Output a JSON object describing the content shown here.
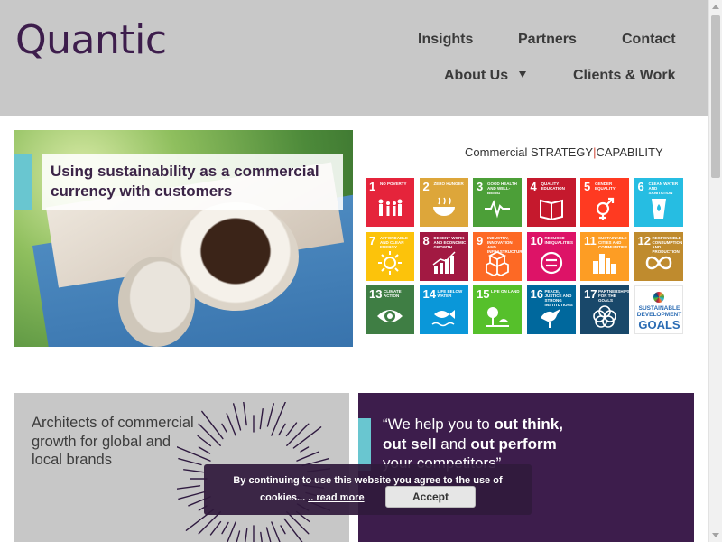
{
  "header": {
    "logo": "Quantic",
    "nav": {
      "insights": "Insights",
      "partners": "Partners",
      "contact": "Contact",
      "about_us": "About Us",
      "clients_work": "Clients & Work"
    }
  },
  "banner": {
    "caption": "Using sustainability as a commercial currency with customers",
    "sdg_title_part1": "Commercial STRATEGY",
    "sdg_title_part2": "CAPABILITY",
    "goals": [
      {
        "num": "1",
        "title": "No poverty",
        "color": "#e5243b",
        "icon": "family-icon"
      },
      {
        "num": "2",
        "title": "Zero hunger",
        "color": "#dda63a",
        "icon": "bowl-icon"
      },
      {
        "num": "3",
        "title": "Good health and well-being",
        "color": "#4c9f38",
        "icon": "heartbeat-icon"
      },
      {
        "num": "4",
        "title": "Quality education",
        "color": "#c5192d",
        "icon": "book-icon"
      },
      {
        "num": "5",
        "title": "Gender equality",
        "color": "#ff3a21",
        "icon": "gender-icon"
      },
      {
        "num": "6",
        "title": "Clean water and sanitation",
        "color": "#26bde2",
        "icon": "water-glass-icon"
      },
      {
        "num": "7",
        "title": "Affordable and clean energy",
        "color": "#fcc30b",
        "icon": "sun-icon"
      },
      {
        "num": "8",
        "title": "Decent work and economic growth",
        "color": "#a21942",
        "icon": "growth-chart-icon"
      },
      {
        "num": "9",
        "title": "Industry, innovation and infrastructure",
        "color": "#fd6925",
        "icon": "cubes-icon"
      },
      {
        "num": "10",
        "title": "Reduced inequalities",
        "color": "#dd1367",
        "icon": "equal-icon"
      },
      {
        "num": "11",
        "title": "Sustainable cities and communities",
        "color": "#fd9d24",
        "icon": "city-icon"
      },
      {
        "num": "12",
        "title": "Responsible consumption and production",
        "color": "#bf8b2e",
        "icon": "infinity-icon"
      },
      {
        "num": "13",
        "title": "Climate action",
        "color": "#3f7e44",
        "icon": "eye-globe-icon"
      },
      {
        "num": "14",
        "title": "Life below water",
        "color": "#0a97d9",
        "icon": "fish-icon"
      },
      {
        "num": "15",
        "title": "Life on land",
        "color": "#56c02b",
        "icon": "tree-icon"
      },
      {
        "num": "16",
        "title": "Peace, justice and strong institutions",
        "color": "#00689d",
        "icon": "dove-icon"
      },
      {
        "num": "17",
        "title": "Partnerships for the goals",
        "color": "#19486a",
        "icon": "rings-icon"
      }
    ],
    "goals_tile_small": "SUSTAINABLE DEVELOPMENT",
    "goals_tile_big": "GOALS"
  },
  "cards": {
    "left_text": "Architects of commercial growth for global and local brands",
    "right_q1": "“We help you to ",
    "right_b1": "out think,",
    "right_b2": "out sell",
    "right_q2": " and ",
    "right_b3": "out perform",
    "right_q3": "your competitors”"
  },
  "cookie": {
    "message_line1": "By continuing to use this website you agree to the use of",
    "message_line2": "cookies...",
    "read_more": ".. read more",
    "accept": "Accept"
  }
}
